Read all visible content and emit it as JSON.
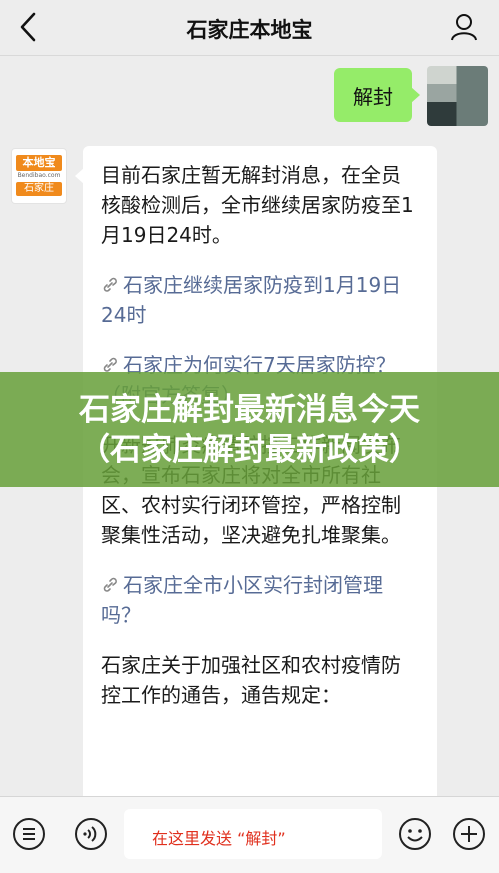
{
  "header": {
    "title": "石家庄本地宝"
  },
  "messages": {
    "me": {
      "text": "解封"
    },
    "bot": {
      "avatar_brand": "本地宝",
      "avatar_url": "Bendibao.com",
      "avatar_city": "石家庄",
      "intro": "目前石家庄暂无解封消息，在全员核酸检测后，全市继续居家防疫至1月19日24时。",
      "link1": "石家庄继续居家防疫到1月19日24时",
      "link2": "石家庄为何实行7天居家防控？（附官方答复）",
      "body2": "开新冠肺炎疫情防控工作新闻发布会，宣布石家庄将对全市所有社区、农村实行闭环管控，严格控制聚集性活动，坚决避免扎堆聚集。",
      "link3": "石家庄全市小区实行封闭管理吗？",
      "body3": "石家庄关于加强社区和农村疫情防控工作的通告，通告规定："
    }
  },
  "banner": {
    "line1": "石家庄解封最新消息今天",
    "line2": "（石家庄解封最新政策）"
  },
  "input": {
    "placeholder": "在这里发送 “解封”"
  },
  "colors": {
    "my_bubble": "#95ec69",
    "link": "#576b95",
    "banner": "#68a03a",
    "hint": "#e0301e"
  }
}
